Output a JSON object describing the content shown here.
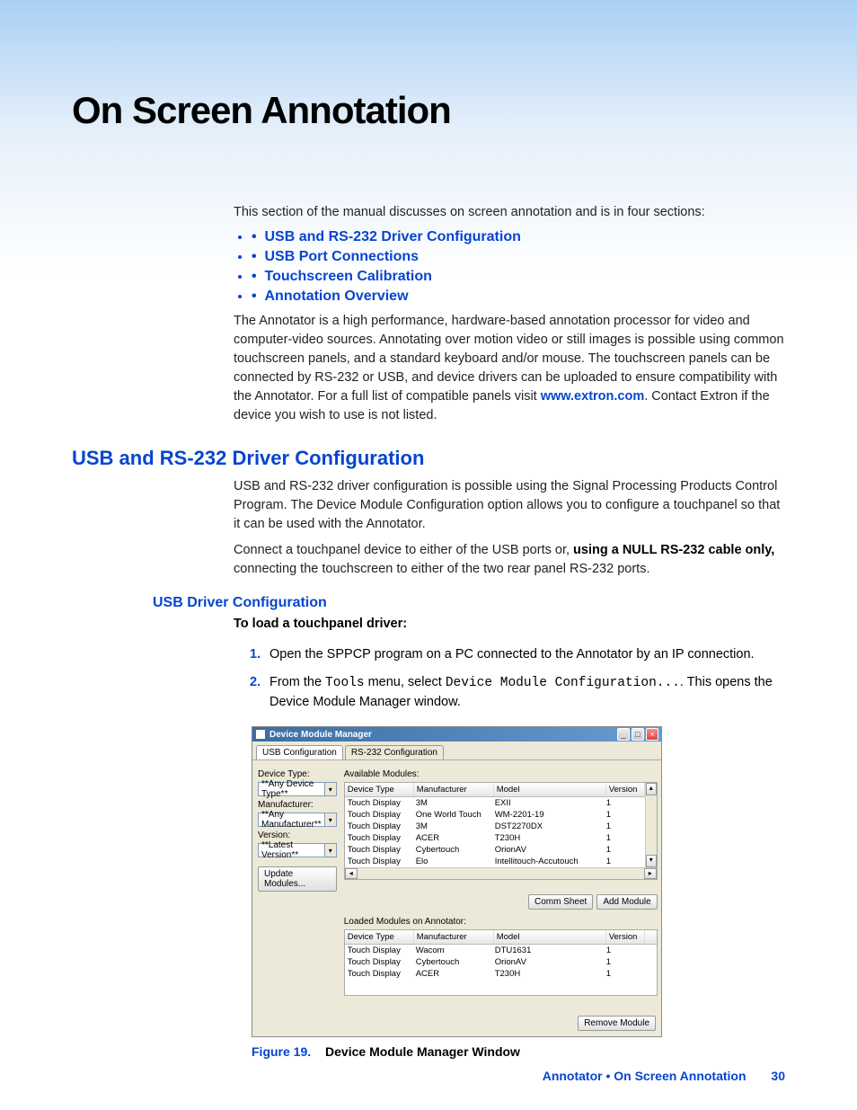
{
  "title": "On Screen Annotation",
  "intro": "This section of the manual discusses on screen annotation and is in four sections:",
  "toc": {
    "i1": "USB and RS-232 Driver Configuration",
    "i2": "USB Port Connections",
    "i3": "Touchscreen Calibration",
    "i4": "Annotation Overview"
  },
  "para1a": "The Annotator is a high performance, hardware-based annotation processor for video and computer-video sources. Annotating over motion video or still images is possible using common touchscreen panels, and a standard keyboard and/or mouse. The touchscreen panels can be connected by RS-232 or USB, and device drivers can be uploaded to ensure compatibility with the Annotator. For a full list of compatible panels visit ",
  "link1": "www.extron.com",
  "para1b": ". Contact Extron if the device you wish to use is not listed.",
  "h2": "USB and RS-232 Driver Configuration",
  "para2": "USB and RS-232 driver configuration is possible using the Signal Processing Products Control Program. The Device Module Configuration option allows you to configure a touchpanel so that it can be used with the Annotator.",
  "para3a": "Connect a touchpanel device to either of the USB ports or, ",
  "para3b": "using a NULL RS-232 cable only,",
  "para3c": " connecting the touchscreen to either of the two rear panel RS-232 ports.",
  "h3": "USB Driver Configuration",
  "h4": "To load a touchpanel driver:",
  "step1": "Open the SPPCP program on a PC connected to the Annotator by an IP connection.",
  "step2a": "From the ",
  "step2b": "Tools",
  "step2c": " menu, select ",
  "step2d": "Device Module Configuration...",
  "step2e": ". This opens the Device Module Manager window.",
  "fig": {
    "num": "Figure 19.",
    "title": "Device Module Manager Window"
  },
  "footer": {
    "doc": "Annotator • On Screen Annotation",
    "page": "30"
  },
  "win": {
    "title": "Device Module Manager",
    "tab1": "USB Configuration",
    "tab2": "RS-232 Configuration",
    "left": {
      "l1": "Device Type:",
      "v1": "**Any Device Type**",
      "l2": "Manufacturer:",
      "v2": "**Any Manufacturer**",
      "l3": "Version:",
      "v3": "**Latest Version**",
      "btn": "Update Modules..."
    },
    "right": {
      "avail": "Available Modules:",
      "cols": {
        "c1": "Device Type",
        "c2": "Manufacturer",
        "c3": "Model",
        "c4": "Version"
      },
      "rows": [
        {
          "c1": "Touch Display",
          "c2": "3M",
          "c3": "EXII",
          "c4": "1"
        },
        {
          "c1": "Touch Display",
          "c2": "One World Touch",
          "c3": "WM-2201-19",
          "c4": "1"
        },
        {
          "c1": "Touch Display",
          "c2": "3M",
          "c3": "DST2270DX",
          "c4": "1"
        },
        {
          "c1": "Touch Display",
          "c2": "ACER",
          "c3": "T230H",
          "c4": "1"
        },
        {
          "c1": "Touch Display",
          "c2": "Cybertouch",
          "c3": "OrionAV",
          "c4": "1"
        },
        {
          "c1": "Touch Display",
          "c2": "Elo",
          "c3": "Intellitouch-Accutouch",
          "c4": "1"
        }
      ],
      "btn1": "Comm Sheet",
      "btn2": "Add Module",
      "loaded": "Loaded Modules on Annotator:",
      "rows2": [
        {
          "c1": "Touch Display",
          "c2": "Wacom",
          "c3": "DTU1631",
          "c4": "1"
        },
        {
          "c1": "Touch Display",
          "c2": "Cybertouch",
          "c3": "OrionAV",
          "c4": "1"
        },
        {
          "c1": "Touch Display",
          "c2": "ACER",
          "c3": "T230H",
          "c4": "1"
        }
      ],
      "btn3": "Remove Module"
    }
  }
}
